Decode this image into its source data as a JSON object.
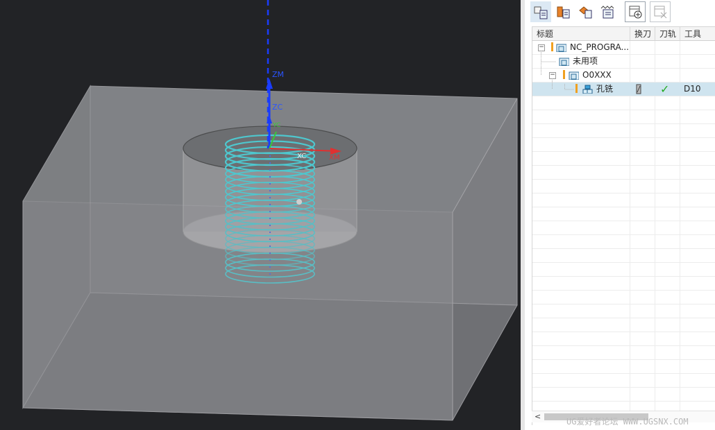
{
  "viewport": {
    "axes": {
      "zm": "ZM",
      "zc": "ZC",
      "xc": "XC",
      "xm": "XM",
      "yc": "YC"
    },
    "colors": {
      "background": "#222326",
      "block": "#7e7f83",
      "toolpath": "#2ee6f0",
      "axis_z": "#1a3cff",
      "axis_x": "#e03030",
      "axis_y": "#38c838"
    }
  },
  "toolbar": {
    "buttons": [
      {
        "icon": "program-order-view-icon",
        "active": true
      },
      {
        "icon": "machine-tool-view-icon",
        "active": false
      },
      {
        "icon": "geometry-view-icon",
        "active": false
      },
      {
        "icon": "machining-method-view-icon",
        "active": false
      },
      {
        "icon": "create-operation-icon",
        "active": false
      },
      {
        "icon": "delete-operation-icon",
        "active": false
      }
    ]
  },
  "navigator": {
    "columns": [
      "标题",
      "换刀",
      "刀轨",
      "工具"
    ],
    "rows": [
      {
        "name": "NC_PROGRA...",
        "tool_change": "",
        "toolpath": "",
        "tool": "",
        "expander": "−",
        "warn": true,
        "icon": "program-folder-icon"
      },
      {
        "name": "未用项",
        "tool_change": "",
        "toolpath": "",
        "tool": "",
        "expander": "",
        "warn": false,
        "icon": "program-folder-icon"
      },
      {
        "name": "O0XXX",
        "tool_change": "",
        "toolpath": "",
        "tool": "",
        "expander": "−",
        "warn": true,
        "icon": "program-folder-icon"
      },
      {
        "name": "孔铣",
        "tool_change": "tool-icon",
        "toolpath": "✓",
        "tool": "D10",
        "expander": "",
        "warn": true,
        "icon": "hole-milling-operation-icon"
      }
    ]
  },
  "scrollbar": {
    "left_arrow": "<"
  },
  "watermark": "UG爱好者论坛 WWW.UGSNX.COM"
}
